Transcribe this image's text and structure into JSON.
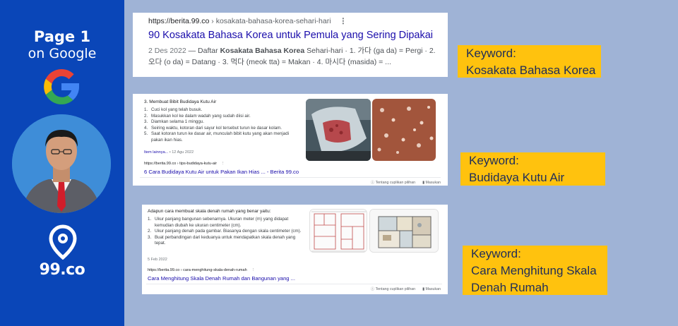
{
  "sidebar": {
    "title_line1": "Page 1",
    "title_line2": "on Google",
    "brand": "99.co"
  },
  "result1": {
    "url_domain": "https://berita.99.co",
    "url_path": " › kosakata-bahasa-korea-sehari-hari",
    "title": "90 Kosakata Bahasa Korea untuk Pemula yang Sering Dipakai",
    "date": "2 Des 2022",
    "snippet_prefix": " — Daftar ",
    "snippet_bold": "Kosakata Bahasa Korea",
    "snippet_rest": " Sehari-hari · 1. 가다 (ga da) = Pergi · 2. 오다 (o da) = Datang · 3. 먹다 (meok tta) = Makan · 4. 마시다 (masida) = ..."
  },
  "result2": {
    "heading": "3. Membuat Bibit Budidaya Kutu Air",
    "items": [
      {
        "num": "1.",
        "text": "Cuci kol yang telah busuk."
      },
      {
        "num": "2.",
        "text": "Masukkan kol ke dalam wadah yang sudah diisi air."
      },
      {
        "num": "3.",
        "text": "Diamkan selama 1 minggu."
      },
      {
        "num": "4.",
        "text": "Seiring waktu, kotoran dari sayur kol tersebut turun ke dasar kolam."
      },
      {
        "num": "5.",
        "text": "Saat kotoran turun ke dasar air, munculah bibit kutu yang akan menjadi pakan ikan hias."
      }
    ],
    "more_link": "Item lainnya...",
    "date": " • 12 Agu 2022",
    "url": "https://berita.99.co › tips-budidaya-kutu-air",
    "title": "6 Cara Budidaya Kutu Air untuk Pakan Ikan Hias ... - Berita 99.co",
    "footer_about": "Tentang cuplikan pilihan",
    "footer_feedback": "Masukan"
  },
  "result3": {
    "heading": "Adapun cara membuat skala denah rumah yang benar yaitu:",
    "items": [
      {
        "num": "1.",
        "text": "Ukur panjang bangunan sebenarnya. Ukuran meter (m) yang didapat kemudian diubah ke ukuran centimeter (cm)."
      },
      {
        "num": "2.",
        "text": "Ukur panjang denah pada gambar. Biasanya dengan skala centimeter (cm)."
      },
      {
        "num": "3.",
        "text": "Buat perbandingan dari keduanya untuk mendapatkan skala denah yang tepat."
      }
    ],
    "date": "5 Feb 2022",
    "url": "https://berita.99.co › cara-menghitung-skala-denah-rumah",
    "title": "Cara Menghitung Skala Denah Rumah dan Bangunan yang ...",
    "footer_about": "Tentang cuplikan pilihan",
    "footer_feedback": "Masukan"
  },
  "keywords": [
    {
      "label": "Keyword:",
      "value": "Kosakata Bahasa Korea"
    },
    {
      "label": "Keyword:",
      "value": "Budidaya Kutu Air"
    },
    {
      "label": "Keyword:",
      "value_line1": "Cara Menghitung Skala",
      "value_line2": "Denah Rumah"
    }
  ],
  "colors": {
    "sidebar": "#0a46b8",
    "background": "#9fb3d6",
    "keyword_box": "#ffc20e",
    "link": "#1a0dab"
  }
}
